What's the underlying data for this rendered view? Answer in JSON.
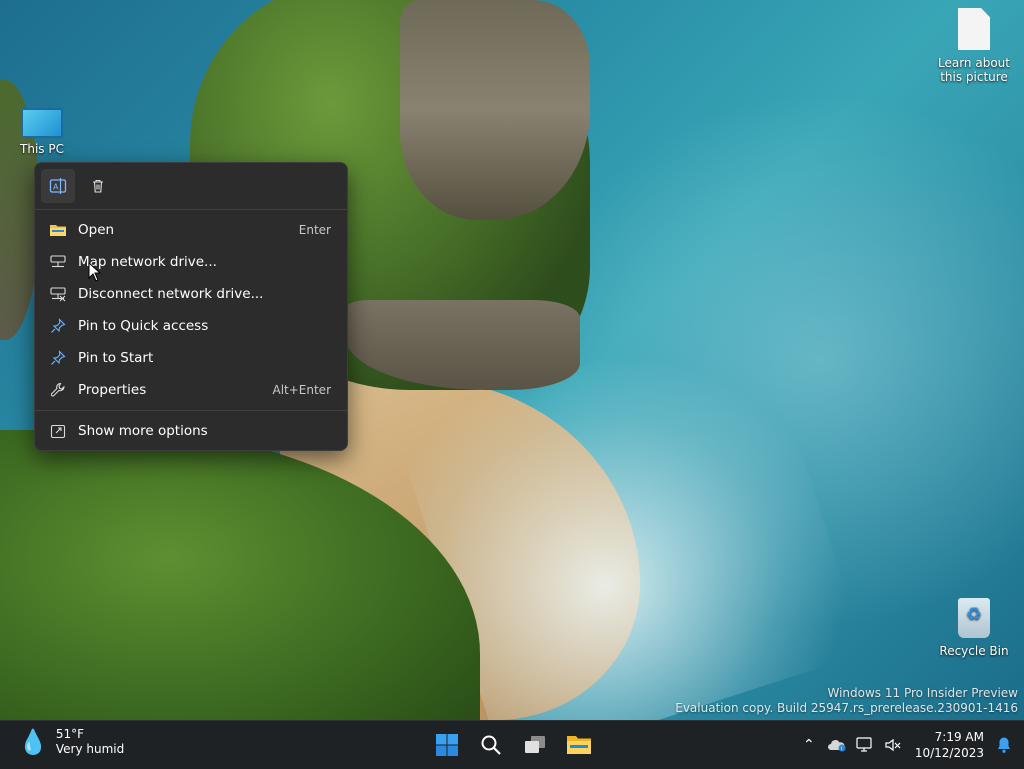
{
  "desktop": {
    "icons": {
      "this_pc": "This PC",
      "learn": "Learn about this picture",
      "recycle": "Recycle Bin"
    },
    "watermark": {
      "line1": "Windows 11 Pro Insider Preview",
      "line2": "Evaluation copy. Build 25947.rs_prerelease.230901-1416"
    }
  },
  "context_menu": {
    "quick_actions": [
      {
        "name": "rename",
        "icon": "rename-icon"
      },
      {
        "name": "delete",
        "icon": "trash-icon"
      }
    ],
    "items": [
      {
        "label": "Open",
        "shortcut": "Enter",
        "icon": "folder-icon"
      },
      {
        "label": "Map network drive...",
        "shortcut": "",
        "icon": "network-drive-icon"
      },
      {
        "label": "Disconnect network drive...",
        "shortcut": "",
        "icon": "disconnect-drive-icon"
      },
      {
        "label": "Pin to Quick access",
        "shortcut": "",
        "icon": "pin-icon"
      },
      {
        "label": "Pin to Start",
        "shortcut": "",
        "icon": "pin-icon"
      },
      {
        "label": "Properties",
        "shortcut": "Alt+Enter",
        "icon": "wrench-icon"
      },
      {
        "label": "Show more options",
        "shortcut": "",
        "icon": "share-icon"
      }
    ]
  },
  "taskbar": {
    "weather": {
      "temp": "51°F",
      "condition": "Very humid"
    },
    "clock": {
      "time": "7:19 AM",
      "date": "10/12/2023"
    },
    "accent": "#0078d4"
  }
}
